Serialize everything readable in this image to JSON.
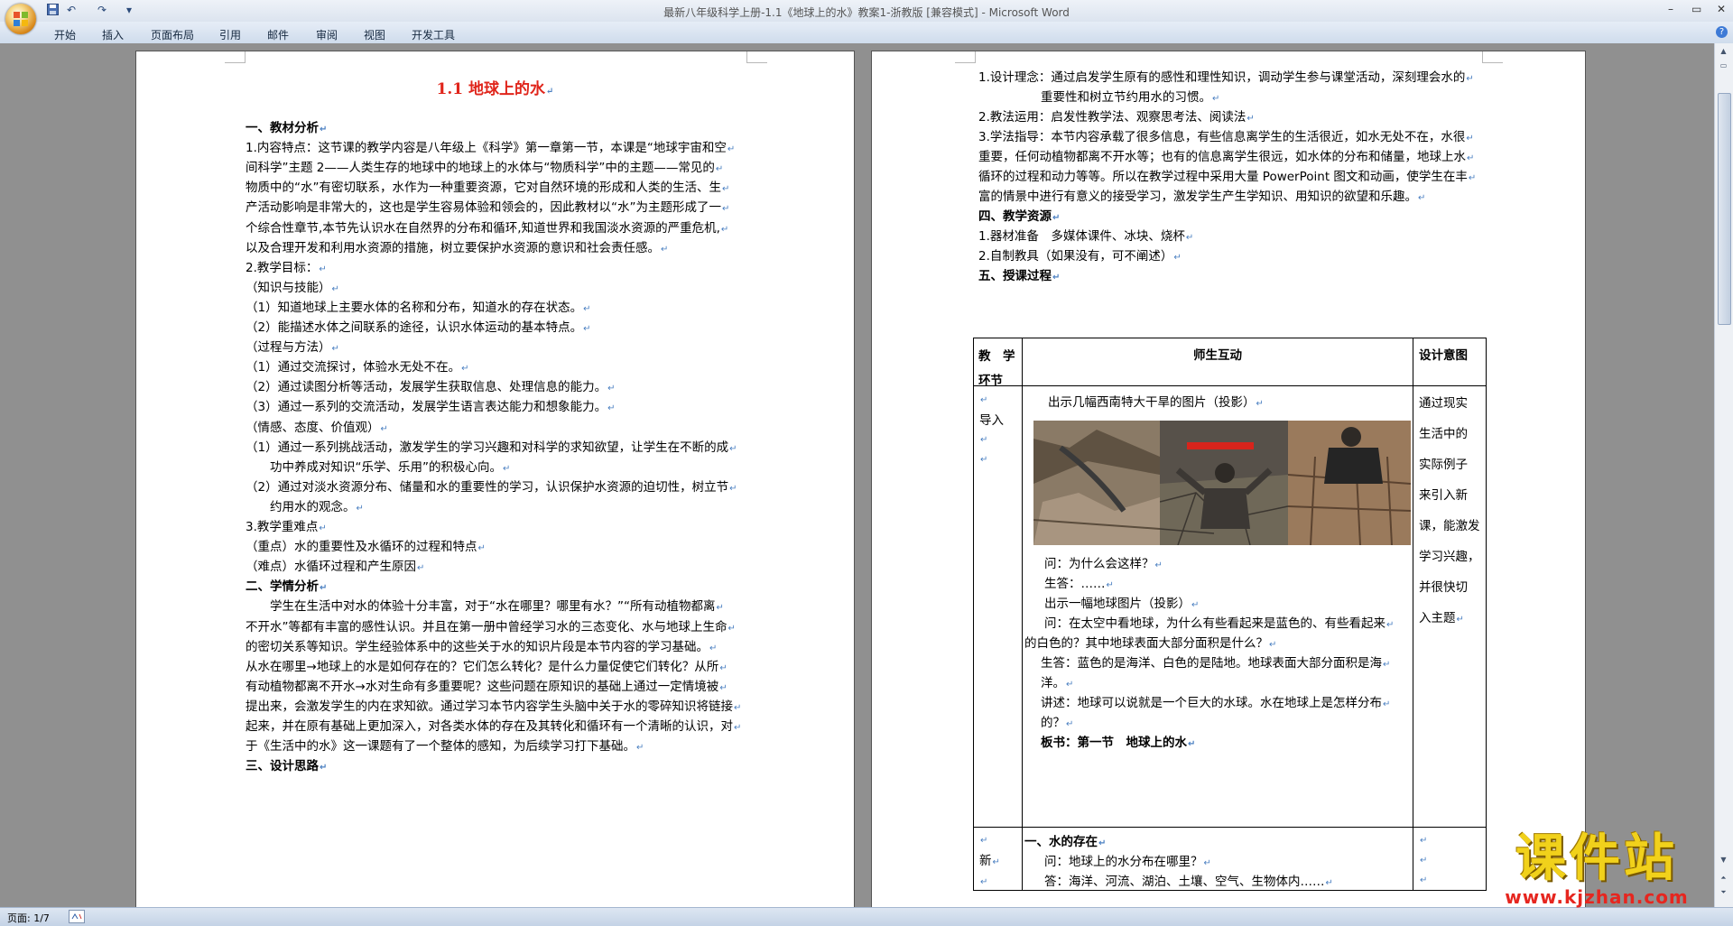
{
  "window": {
    "title": "最新八年级科学上册-1.1《地球上的水》教案1-浙教版 [兼容模式] - Microsoft Word",
    "controls": [
      "–",
      "▭",
      "✕"
    ]
  },
  "quick_access": {
    "save_icon": "save-icon",
    "undo": "↶",
    "redo": "↷",
    "more": "▾"
  },
  "ribbon": {
    "tabs": [
      "开始",
      "插入",
      "页面布局",
      "引用",
      "邮件",
      "审阅",
      "视图",
      "开发工具"
    ],
    "help": "?"
  },
  "page1": {
    "title": "1.1 地球上的水",
    "lines": [
      {
        "t": "一、教材分析",
        "b": true
      },
      {
        "t": "1.内容特点：这节课的教学内容是八年级上《科学》第一章第一节，本课是“地球宇宙和空"
      },
      {
        "t": "间科学”主题 2——人类生存的地球中的地球上的水体与“物质科学”中的主题——常见的"
      },
      {
        "t": "物质中的“水”有密切联系，水作为一种重要资源，它对自然环境的形成和人类的生活、生"
      },
      {
        "t": "产活动影响是非常大的，这也是学生容易体验和领会的，因此教材以“水”为主题形成了一"
      },
      {
        "t": "个综合性章节,本节先认识水在自然界的分布和循环,知道世界和我国淡水资源的严重危机,"
      },
      {
        "t": "以及合理开发和利用水资源的措施，树立要保护水资源的意识和社会责任感。"
      },
      {
        "t": "2.教学目标："
      },
      {
        "t": "（知识与技能）"
      },
      {
        "t": "（1）知道地球上主要水体的名称和分布，知道水的存在状态。"
      },
      {
        "t": "（2）能描述水体之间联系的途径，认识水体运动的基本特点。"
      },
      {
        "t": "（过程与方法）"
      },
      {
        "t": "（1）通过交流探讨，体验水无处不在。"
      },
      {
        "t": "（2）通过读图分析等活动，发展学生获取信息、处理信息的能力。"
      },
      {
        "t": "（3）通过一系列的交流活动，发展学生语言表达能力和想象能力。"
      },
      {
        "t": "（情感、态度、价值观）"
      },
      {
        "t": "（1）通过一系列挑战活动，激发学生的学习兴趣和对科学的求知欲望，让学生在不断的成"
      },
      {
        "t": "功中养成对知识“乐学、乐用”的积极心向。",
        "i": true
      },
      {
        "t": "（2）通过对淡水资源分布、储量和水的重要性的学习，认识保护水资源的迫切性，树立节"
      },
      {
        "t": "约用水的观念。",
        "i": true
      },
      {
        "t": "3.教学重难点"
      },
      {
        "t": "（重点）水的重要性及水循环的过程和特点"
      },
      {
        "t": "（难点）水循环过程和产生原因"
      },
      {
        "t": "二、学情分析",
        "b": true
      },
      {
        "t": "学生在生活中对水的体验十分丰富，对于“水在哪里？哪里有水？”“所有动植物都离",
        "i": true
      },
      {
        "t": "不开水”等都有丰富的感性认识。并且在第一册中曾经学习水的三态变化、水与地球上生命"
      },
      {
        "t": "的密切关系等知识。学生经验体系中的这些关于水的知识片段是本节内容的学习基础。"
      },
      {
        "t": "从水在哪里→地球上的水是如何存在的？它们怎么转化？是什么力量促使它们转化？从所"
      },
      {
        "t": "有动植物都离不开水→水对生命有多重要呢？这些问题在原知识的基础上通过一定情境被"
      },
      {
        "t": "提出来，会激发学生的内在求知欲。通过学习本节内容学生头脑中关于水的零碎知识将链接"
      },
      {
        "t": "起来，并在原有基础上更加深入，对各类水体的存在及其转化和循环有一个清晰的认识，对"
      },
      {
        "t": "于《生活中的水》这一课题有了一个整体的感知，为后续学习打下基础。"
      },
      {
        "t": "三、设计思路",
        "b": true
      }
    ]
  },
  "page2": {
    "lines": [
      {
        "t": "1.设计理念：通过启发学生原有的感性和理性知识，调动学生参与课堂活动，深刻理会水的"
      },
      {
        "t": "重要性和树立节约用水的习惯。",
        "i": true
      },
      {
        "t": "2.教法运用：启发性教学法、观察思考法、阅读法"
      },
      {
        "t": "3.学法指导：本节内容承载了很多信息，有些信息离学生的生活很近，如水无处不在，水很"
      },
      {
        "t": "重要，任何动植物都离不开水等；也有的信息离学生很远，如水体的分布和储量，地球上水"
      },
      {
        "t": "循环的过程和动力等等。所以在教学过程中采用大量 PowerPoint 图文和动画，使学生在丰"
      },
      {
        "t": "富的情景中进行有意义的接受学习，激发学生产生学知识、用知识的欲望和乐趣。"
      },
      {
        "t": "四、教学资源",
        "b": true
      },
      {
        "t": "1.器材准备　多媒体课件、冰块、烧杯"
      },
      {
        "t": "2.自制教具（如果没有，可不阐述）"
      },
      {
        "t": "五、授课过程",
        "b": true
      }
    ],
    "table": {
      "headers": [
        "教　学环节",
        "师生互动",
        "设计意图"
      ],
      "stage1": "导入",
      "intro_lines": [
        "出示几幅西南特大干旱的图片（投影）"
      ],
      "photo_names": [
        "drought-photo-1",
        "drought-photo-2",
        "drought-photo-3"
      ],
      "mid_lines": [
        {
          "t": "问：为什么会这样？",
          "x": 24
        },
        {
          "t": "生答：……",
          "x": 24
        },
        {
          "t": "出示一幅地球图片（投影）",
          "x": 24
        },
        {
          "t": "问：在太空中看地球，为什么有些看起来是蓝色的、有些看起来",
          "x": 24
        },
        {
          "t": "的白色的？其中地球表面大部分面积是什么？",
          "x": 2
        },
        {
          "t": "生答：蓝色的是海洋、白色的是陆地。地球表面大部分面积是海",
          "x": 20
        },
        {
          "t": "洋。",
          "x": 20
        },
        {
          "t": "讲述：地球可以说就是一个巨大的水球。水在地球上是怎样分布",
          "x": 20
        },
        {
          "t": "的？",
          "x": 20
        },
        {
          "t": "板书：第一节　地球上的水",
          "x": 20,
          "b": true
        }
      ],
      "intent1": [
        "通过现实",
        "生活中的",
        "实际例子",
        "来引入新",
        "课，能激发",
        "学习兴趣，",
        "并很快切",
        "入主题"
      ],
      "stage2": "新",
      "row2_lines": [
        {
          "t": "一、水的存在",
          "b": true,
          "x": 2
        },
        {
          "t": "问：地球上的水分布在哪里？",
          "x": 24
        },
        {
          "t": "答：海洋、河流、湖泊、土壤、空气、生物体内……",
          "x": 24
        }
      ]
    }
  },
  "statusbar": {
    "page": "页面: 1/7"
  },
  "watermark": {
    "title": "课件站",
    "url": "www.kjzhan.com"
  }
}
